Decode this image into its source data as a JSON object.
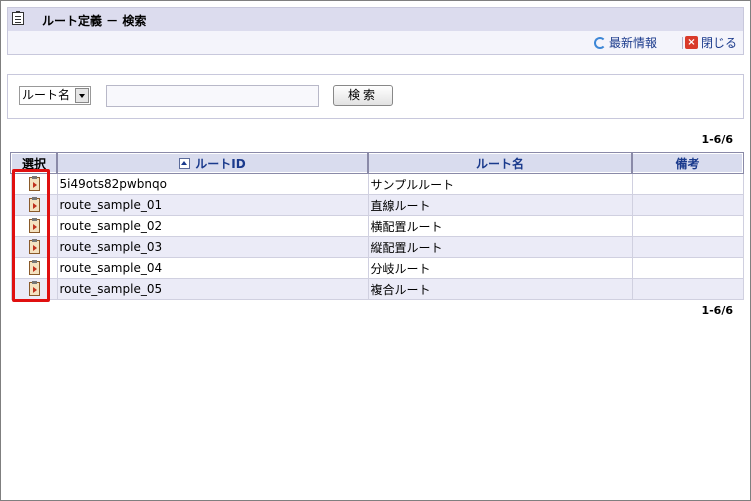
{
  "title": "ルート定義 － 検索",
  "toolbar": {
    "latest_info": "最新情報",
    "close": "閉じる"
  },
  "search": {
    "field_select": "ルート名",
    "input_value": "",
    "button": "検索"
  },
  "pager": {
    "top": "1-6/6",
    "bottom": "1-6/6"
  },
  "table": {
    "headers": {
      "select": "選択",
      "route_id": "ルートID",
      "route_name": "ルート名",
      "note": "備考"
    },
    "rows": [
      {
        "id": "5i49ots82pwbnqo",
        "name": "サンプルルート",
        "note": ""
      },
      {
        "id": "route_sample_01",
        "name": "直線ルート",
        "note": ""
      },
      {
        "id": "route_sample_02",
        "name": "横配置ルート",
        "note": ""
      },
      {
        "id": "route_sample_03",
        "name": "縦配置ルート",
        "note": ""
      },
      {
        "id": "route_sample_04",
        "name": "分岐ルート",
        "note": ""
      },
      {
        "id": "route_sample_05",
        "name": "複合ルート",
        "note": ""
      }
    ]
  },
  "colors": {
    "accent": "#1a3a8c",
    "header_bg": "#d9dcee",
    "highlight": "#e01010"
  }
}
